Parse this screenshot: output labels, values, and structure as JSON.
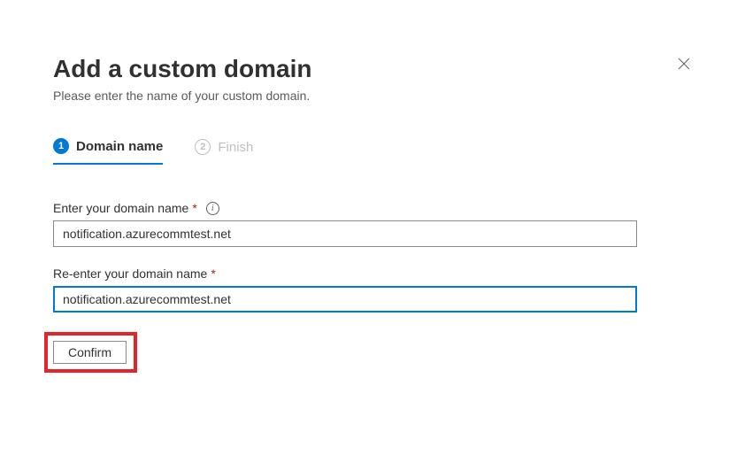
{
  "header": {
    "title": "Add a custom domain",
    "subtitle": "Please enter the name of your custom domain."
  },
  "steps": [
    {
      "number": "1",
      "label": "Domain name"
    },
    {
      "number": "2",
      "label": "Finish"
    }
  ],
  "form": {
    "field1": {
      "label": "Enter your domain name",
      "value": "notification.azurecommtest.net"
    },
    "field2": {
      "label": "Re-enter your domain name",
      "value": "notification.azurecommtest.net"
    },
    "confirm_label": "Confirm"
  }
}
